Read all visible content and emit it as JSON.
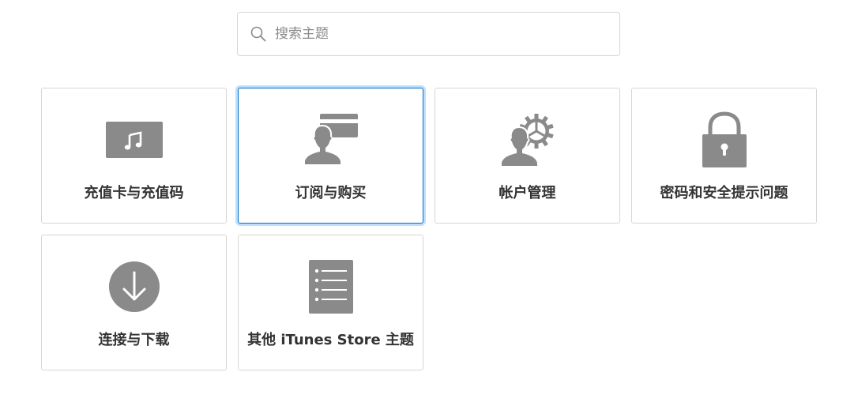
{
  "search": {
    "placeholder": "搜索主题"
  },
  "colors": {
    "icon_gray": "#8a8a8a",
    "border": "#d6d6d6",
    "selected_border": "#0070c9",
    "label_text": "#333333"
  },
  "topics": [
    {
      "label": "充值卡与充值码",
      "icon": "music-card-icon",
      "selected": false
    },
    {
      "label": "订阅与购买",
      "icon": "person-card-icon",
      "selected": true
    },
    {
      "label": "帐户管理",
      "icon": "person-gear-icon",
      "selected": false
    },
    {
      "label": "密码和安全提示问题",
      "icon": "lock-icon",
      "selected": false
    },
    {
      "label": "连接与下载",
      "icon": "download-icon",
      "selected": false
    },
    {
      "label": "其他 iTunes Store 主题",
      "icon": "list-document-icon",
      "selected": false
    }
  ]
}
